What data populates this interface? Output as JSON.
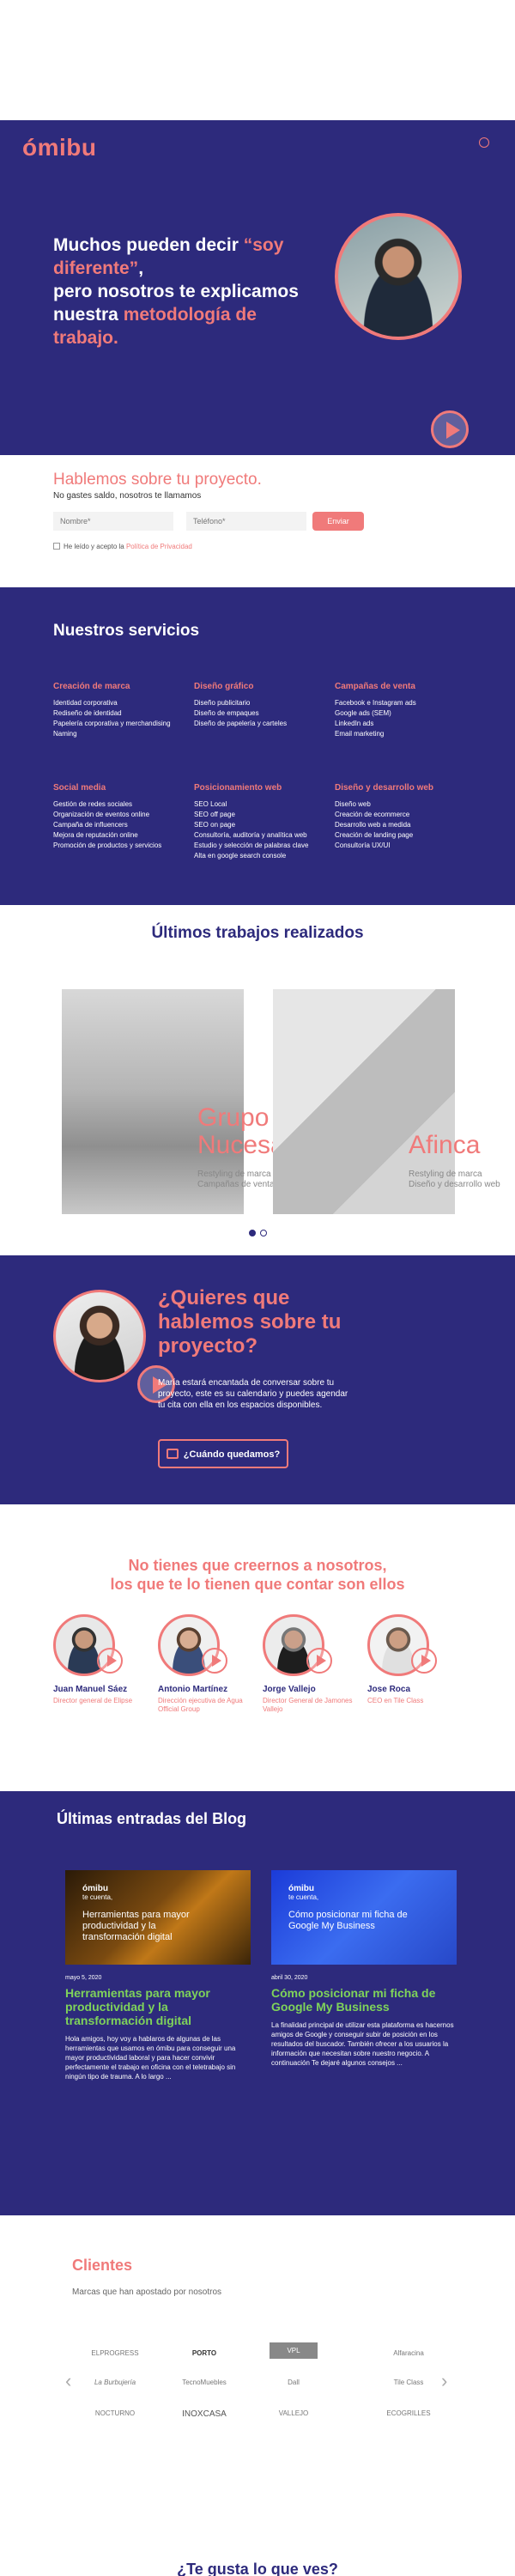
{
  "brand": {
    "logo": "ómibu"
  },
  "hero": {
    "line1": "Muchos pueden decir ",
    "highlight1": "“soy diferente”",
    "line2": ",",
    "line3": "pero nosotros te explicamos nuestra ",
    "highlight2": "metodología de trabajo."
  },
  "contact": {
    "title": "Hablemos sobre tu proyecto.",
    "subtitle": "No gastes saldo, nosotros te llamamos",
    "name_placeholder": "Nombre*",
    "phone_placeholder": "Teléfono*",
    "send": "Enviar",
    "privacy_text": "He leído y acepto la ",
    "privacy_link": "Política de Privacidad"
  },
  "services": {
    "title": "Nuestros servicios",
    "groups": [
      {
        "title": "Creación de marca",
        "items": [
          "Identidad corporativa",
          "Rediseño de identidad",
          "Papelería corporativa y merchandising",
          "Naming"
        ]
      },
      {
        "title": "Diseño gráfico",
        "items": [
          "Diseño publicitario",
          "Diseño de empaques",
          "Diseño de papelería y carteles"
        ]
      },
      {
        "title": "Campañas de venta",
        "items": [
          "Facebook e Instagram ads",
          "Google ads (SEM)",
          "LinkedIn ads",
          "Email marketing"
        ]
      },
      {
        "title": "Social media",
        "items": [
          "Gestión de redes sociales",
          "Organización de eventos online",
          "Campaña de influencers",
          "Mejora de reputación online",
          "Promoción de productos y servicios"
        ]
      },
      {
        "title": "Posicionamiento web",
        "items": [
          "SEO Local",
          "SEO off page",
          "SEO on page",
          "Consultoría, auditoría y analítica web",
          "Estudio y selección de palabras clave",
          "Alta en google search console"
        ]
      },
      {
        "title": "Diseño y desarrollo web",
        "items": [
          "Diseño web",
          "Creación de ecommerce",
          "Desarrollo web a medida",
          "Creación de landing page",
          "Consultoría UX/UI"
        ]
      }
    ]
  },
  "works": {
    "title": "Últimos trabajos realizados",
    "items": [
      {
        "name1": "Grupo",
        "name2": "Nucesa",
        "tag1": "Restyling de marca",
        "tag2": "Campañas de venta online"
      },
      {
        "name1": "",
        "name2": "Afinca",
        "tag1": "Restyling de marca",
        "tag2": "Diseño y desarrollo web"
      }
    ]
  },
  "cta": {
    "title": "¿Quieres que hablemos sobre tu proyecto?",
    "text": "María estará encantada de conversar sobre tu proyecto, este es su calendario y puedes agendar tu cita con ella en los espacios disponibles.",
    "button": "¿Cuándo quedamos?"
  },
  "testimonials": {
    "title_line1": "No tienes que creernos a nosotros,",
    "title_line2": "los que te lo tienen que contar son ellos",
    "people": [
      {
        "name": "Juan Manuel Sáez",
        "role": "Director general de Elipse"
      },
      {
        "name": "Antonio Martínez",
        "role": "Dirección ejecutiva de Agua Official Group"
      },
      {
        "name": "Jorge Vallejo",
        "role": "Director General de Jamones Vallejo"
      },
      {
        "name": "Jose Roca",
        "role": "CEO en Tile Class"
      }
    ]
  },
  "blog": {
    "title": "Últimas entradas del Blog",
    "posts": [
      {
        "brand": "ómibu",
        "brand_sub": "te cuenta,",
        "img_title": "Herramientas para mayor productividad y la transformación digital",
        "date": "mayo 5, 2020",
        "title": "Herramientas para mayor productividad y la transformación digital",
        "excerpt": "Hola amigos, hoy voy a hablaros de algunas de las herramientas que usamos en ómibu para conseguir una mayor productividad laboral y para hacer convivir perfectamente el trabajo en oficina con el teletrabajo sin ningún tipo de trauma. A lo largo ..."
      },
      {
        "brand": "ómibu",
        "brand_sub": "te cuenta,",
        "img_title": "Cómo posicionar mi ficha de Google My Business",
        "date": "abril 30, 2020",
        "title": "Cómo posicionar mi ficha de Google My Business",
        "excerpt": "La finalidad principal de utilizar esta plataforma es hacernos amigos de Google y conseguir subir de posición en los resultados del buscador. También ofrecer a los usuarios la información que necesitan sobre nuestro negocio. A continuación Te dejaré algunos consejos ..."
      }
    ]
  },
  "clients": {
    "title": "Clientes",
    "subtitle": "Marcas que han apostado por nosotros",
    "logos": [
      "ELPROGRESS",
      "PORTO",
      "VPL",
      "Alfaracina",
      "La Burbujería",
      "TecnoMuebles",
      "Dall",
      "Tile Class",
      "NOCTURNO",
      "INOXCASA",
      "VALLEJO",
      "ECOGRILLES"
    ],
    "prev": "‹",
    "next": "›"
  },
  "footer": {
    "title": "¿Te gusta lo que ves?"
  },
  "colors": {
    "navy": "#2d2a7c",
    "coral": "#f07a7a",
    "green": "#7fd35a"
  }
}
